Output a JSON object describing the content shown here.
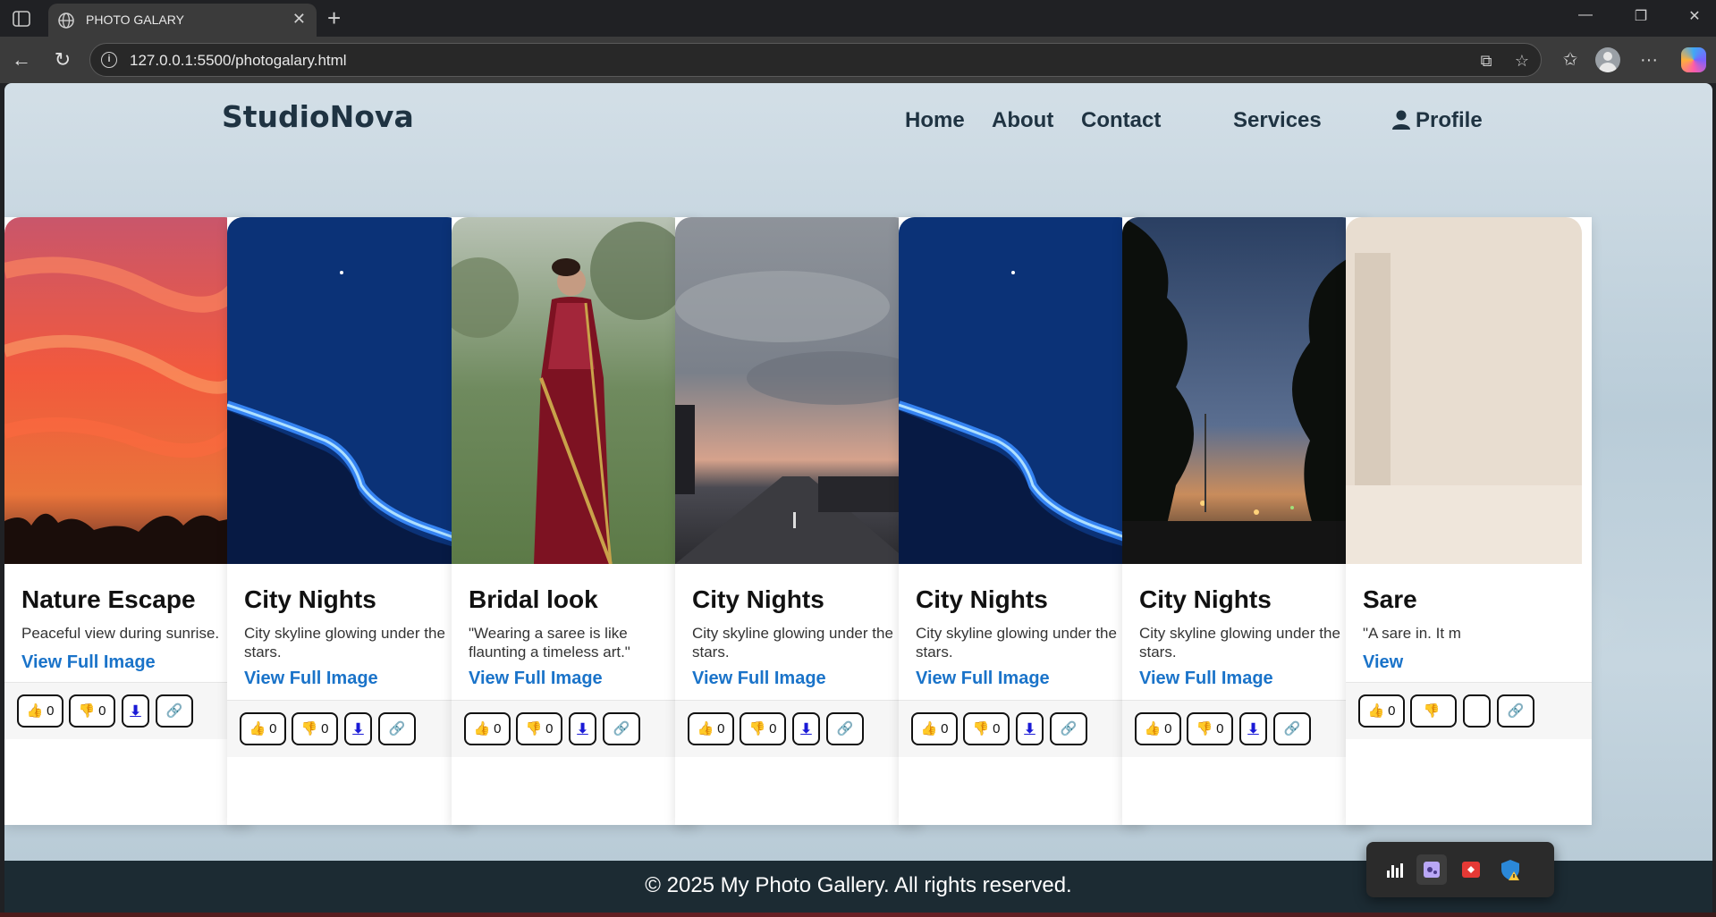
{
  "browser": {
    "tab_title": "PHOTO GALARY",
    "url": "127.0.0.1:5500/photogalary.html"
  },
  "site": {
    "logo": "StudioNova",
    "nav": {
      "home": "Home",
      "about": "About",
      "contact": "Contact",
      "services": "Services",
      "profile": "Profile"
    },
    "footer": "© 2025 My Photo Gallery. All rights reserved."
  },
  "cards": [
    {
      "title": "Nature Escape",
      "desc": "Peaceful view during sunrise.",
      "link": "View Full Image",
      "likes": "0",
      "dislikes": "0",
      "download": "⬇",
      "image": "sunset-sky"
    },
    {
      "title": "City Nights",
      "desc": "City skyline glowing under the stars.",
      "link": "View Full Image",
      "likes": "0",
      "dislikes": "0",
      "download": "⬇",
      "image": "glowing-waves"
    },
    {
      "title": "Bridal look",
      "desc": "\"Wearing a saree is like flaunting a timeless art.\"",
      "link": "View Full Image",
      "likes": "0",
      "dislikes": "0",
      "download": "⬇",
      "image": "bride-saree"
    },
    {
      "title": "City Nights",
      "desc": "City skyline glowing under the stars.",
      "link": "View Full Image",
      "likes": "0",
      "dislikes": "0",
      "download": "⬇",
      "image": "dusk-road"
    },
    {
      "title": "City Nights",
      "desc": "City skyline glowing under the stars.",
      "link": "View Full Image",
      "likes": "0",
      "dislikes": "0",
      "download": "⬇",
      "image": "glowing-waves"
    },
    {
      "title": "City Nights",
      "desc": "City skyline glowing under the stars.",
      "link": "View Full Image",
      "likes": "0",
      "dislikes": "0",
      "download": "⬇",
      "image": "night-trees"
    },
    {
      "title": "Sare",
      "desc": "\"A sare in. It m",
      "link": "View",
      "likes": "0",
      "dislikes": "",
      "download": "",
      "image": "interior"
    }
  ],
  "colors": {
    "accent_link": "#1a73c9",
    "header_text": "#1f3342",
    "footer_bg": "#1c2b33"
  }
}
